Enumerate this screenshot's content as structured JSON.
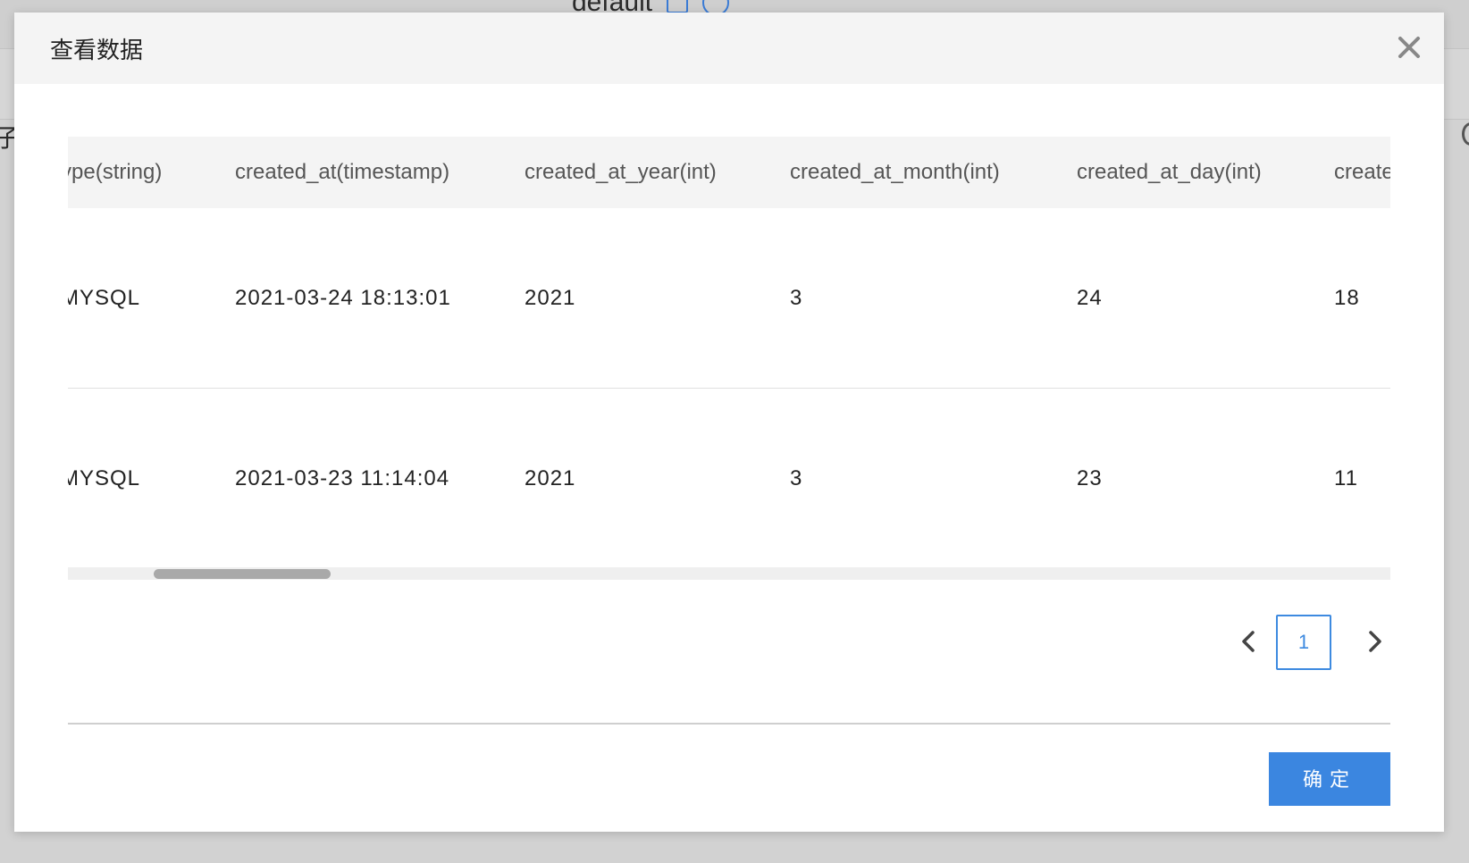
{
  "background": {
    "title": "default",
    "left_fragment": "子女"
  },
  "modal": {
    "title": "查看数据",
    "columns": [
      "ype(string)",
      "created_at(timestamp)",
      "created_at_year(int)",
      "created_at_month(int)",
      "created_at_day(int)",
      "create"
    ],
    "rows": [
      [
        "MYSQL",
        "2021-03-24 18:13:01",
        "2021",
        "3",
        "24",
        "18"
      ],
      [
        "MYSQL",
        "2021-03-23 11:14:04",
        "2021",
        "3",
        "23",
        "11"
      ]
    ],
    "pagination": {
      "current_page": "1"
    },
    "ok_label": "确定"
  },
  "colors": {
    "accent": "#3b86e0",
    "header_bg": "#f4f4f4"
  },
  "icons": {
    "close": "close-icon",
    "prev": "chevron-left-icon",
    "next": "chevron-right-icon"
  }
}
